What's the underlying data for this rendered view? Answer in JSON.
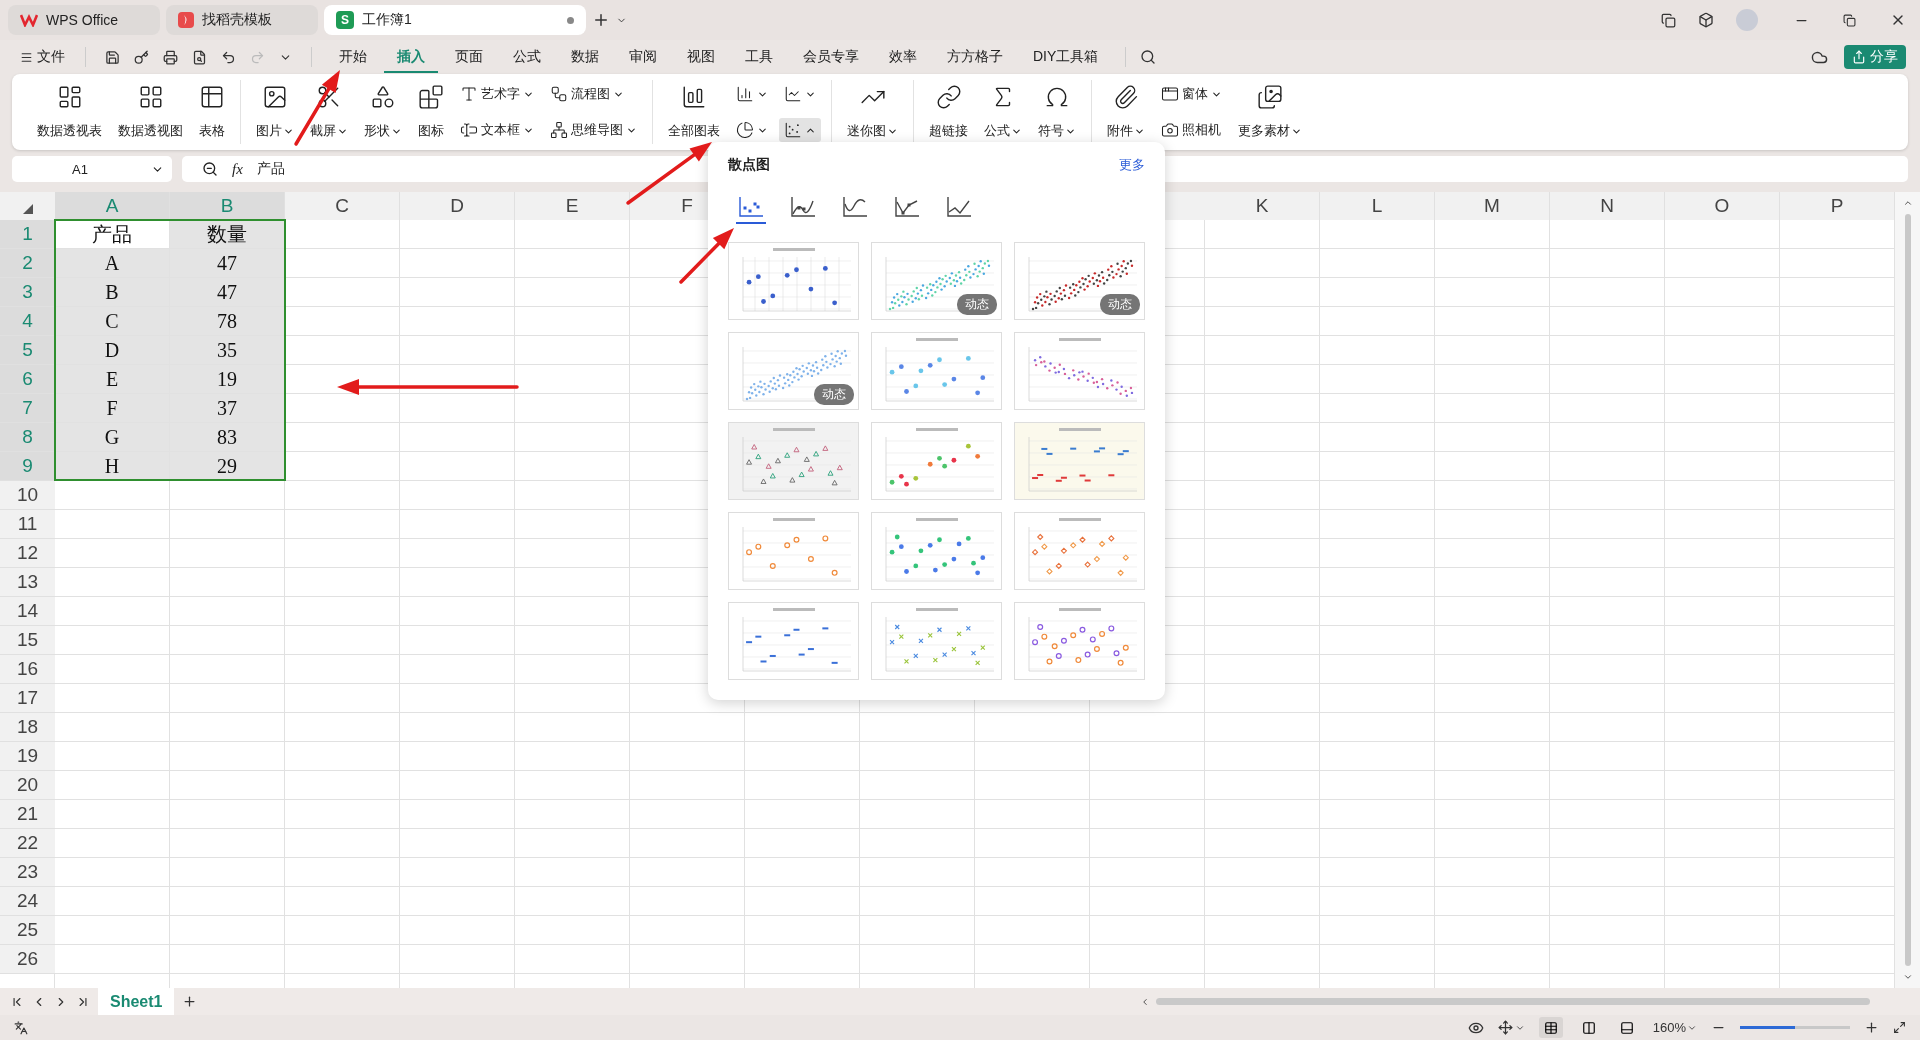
{
  "title_bar": {
    "tabs": [
      {
        "label": "WPS Office",
        "selected": false,
        "kind": "wps"
      },
      {
        "label": "找稻壳模板",
        "selected": false,
        "kind": "docer"
      },
      {
        "label": "工作簿1",
        "selected": true,
        "kind": "sheet",
        "logo": "S",
        "unsaved": true
      }
    ]
  },
  "menu": {
    "file": "文件",
    "quick_access": [
      {
        "disabled": false
      },
      {
        "disabled": false
      },
      {
        "disabled": false
      },
      {
        "disabled": false
      },
      {
        "disabled": false
      },
      {
        "disabled": true
      },
      {
        "disabled": false
      }
    ],
    "tabs": [
      {
        "label": "开始",
        "selected": false
      },
      {
        "label": "插入",
        "selected": true
      },
      {
        "label": "页面",
        "selected": false
      },
      {
        "label": "公式",
        "selected": false
      },
      {
        "label": "数据",
        "selected": false
      },
      {
        "label": "审阅",
        "selected": false
      },
      {
        "label": "视图",
        "selected": false
      },
      {
        "label": "工具",
        "selected": false
      },
      {
        "label": "会员专享",
        "selected": false
      },
      {
        "label": "效率",
        "selected": false
      },
      {
        "label": "方方格子",
        "selected": false
      },
      {
        "label": "DIY工具箱",
        "selected": false
      }
    ],
    "share": "分享"
  },
  "ribbon": {
    "groups": [
      {
        "columns": [
          {
            "kind": "large",
            "items": [
              {
                "label": "数据透视表",
                "caret": false
              }
            ]
          },
          {
            "kind": "large",
            "items": [
              {
                "label": "数据透视图",
                "caret": false
              }
            ]
          },
          {
            "kind": "large",
            "items": [
              {
                "label": "表格",
                "caret": false
              }
            ]
          }
        ]
      },
      {
        "columns": [
          {
            "kind": "large",
            "items": [
              {
                "label": "图片",
                "caret": true
              }
            ]
          },
          {
            "kind": "large",
            "items": [
              {
                "label": "截屏",
                "caret": true
              }
            ]
          },
          {
            "kind": "large",
            "items": [
              {
                "label": "形状",
                "caret": true
              }
            ]
          },
          {
            "kind": "large",
            "items": [
              {
                "label": "图标",
                "caret": false
              }
            ]
          },
          {
            "kind": "stack",
            "items": [
              {
                "label": "艺术字",
                "caret": true
              },
              {
                "label": "文本框",
                "caret": true
              }
            ]
          },
          {
            "kind": "stack",
            "items": [
              {
                "label": "流程图",
                "caret": true
              },
              {
                "label": "思维导图",
                "caret": true
              }
            ]
          }
        ]
      },
      {
        "columns": [
          {
            "kind": "large",
            "items": [
              {
                "label": "全部图表",
                "caret": false
              }
            ]
          },
          {
            "kind": "stack",
            "items": [
              {
                "caret": true,
                "open": false
              },
              {
                "caret": true,
                "open": false
              }
            ]
          },
          {
            "kind": "stack",
            "items": [
              {
                "caret": true,
                "open": false
              },
              {
                "caret": true,
                "open": true
              }
            ]
          }
        ]
      },
      {
        "columns": [
          {
            "kind": "large",
            "items": [
              {
                "label": "迷你图",
                "caret": true
              }
            ]
          }
        ]
      },
      {
        "columns": [
          {
            "kind": "large",
            "items": [
              {
                "label": "超链接",
                "caret": false
              }
            ]
          },
          {
            "kind": "large",
            "items": [
              {
                "label": "公式",
                "caret": true
              }
            ]
          },
          {
            "kind": "large",
            "items": [
              {
                "label": "符号",
                "caret": true
              }
            ]
          }
        ]
      },
      {
        "columns": [
          {
            "kind": "large",
            "items": [
              {
                "label": "附件",
                "caret": true
              }
            ]
          },
          {
            "kind": "stack",
            "items": [
              {
                "label": "窗体",
                "caret": true
              },
              {
                "label": "照相机",
                "caret": false
              }
            ]
          },
          {
            "kind": "large",
            "items": [
              {
                "label": "更多素材",
                "caret": true
              }
            ]
          }
        ]
      }
    ]
  },
  "formula_bar": {
    "name_box": "A1",
    "fx": "fx",
    "formula": "产品"
  },
  "sheet": {
    "columns": [
      {
        "label": "A",
        "selected": true
      },
      {
        "label": "B",
        "selected": true
      },
      {
        "label": "C",
        "selected": false
      },
      {
        "label": "D",
        "selected": false
      },
      {
        "label": "E",
        "selected": false
      },
      {
        "label": "F",
        "selected": false
      },
      {
        "label": "K",
        "selected": false
      },
      {
        "label": "L",
        "selected": false
      },
      {
        "label": "M",
        "selected": false
      },
      {
        "label": "N",
        "selected": false
      },
      {
        "label": "O",
        "selected": false
      },
      {
        "label": "P",
        "selected": false
      }
    ],
    "rows": [
      {
        "label": "1",
        "selected": true,
        "cells": [
          {
            "text": "产品",
            "active": true
          },
          {
            "text": "数量",
            "active": false
          }
        ]
      },
      {
        "label": "2",
        "selected": true,
        "cells": [
          {
            "text": "A",
            "active": false
          },
          {
            "text": "47",
            "active": false
          }
        ]
      },
      {
        "label": "3",
        "selected": true,
        "cells": [
          {
            "text": "B",
            "active": false
          },
          {
            "text": "47",
            "active": false
          }
        ]
      },
      {
        "label": "4",
        "selected": true,
        "cells": [
          {
            "text": "C",
            "active": false
          },
          {
            "text": "78",
            "active": false
          }
        ]
      },
      {
        "label": "5",
        "selected": true,
        "cells": [
          {
            "text": "D",
            "active": false
          },
          {
            "text": "35",
            "active": false
          }
        ]
      },
      {
        "label": "6",
        "selected": true,
        "cells": [
          {
            "text": "E",
            "active": false
          },
          {
            "text": "19",
            "active": false
          }
        ]
      },
      {
        "label": "7",
        "selected": true,
        "cells": [
          {
            "text": "F",
            "active": false
          },
          {
            "text": "37",
            "active": false
          }
        ]
      },
      {
        "label": "8",
        "selected": true,
        "cells": [
          {
            "text": "G",
            "active": false
          },
          {
            "text": "83",
            "active": false
          }
        ]
      },
      {
        "label": "9",
        "selected": true,
        "cells": [
          {
            "text": "H",
            "active": false
          },
          {
            "text": "29",
            "active": false
          }
        ]
      },
      {
        "label": "10",
        "selected": false
      },
      {
        "label": "11",
        "selected": false
      },
      {
        "label": "12",
        "selected": false
      },
      {
        "label": "13",
        "selected": false
      },
      {
        "label": "14",
        "selected": false
      },
      {
        "label": "15",
        "selected": false
      },
      {
        "label": "16",
        "selected": false
      },
      {
        "label": "17",
        "selected": false
      },
      {
        "label": "18",
        "selected": false
      },
      {
        "label": "19",
        "selected": false
      },
      {
        "label": "20",
        "selected": false
      },
      {
        "label": "21",
        "selected": false
      },
      {
        "label": "22",
        "selected": false
      },
      {
        "label": "23",
        "selected": false
      },
      {
        "label": "24",
        "selected": false
      },
      {
        "label": "25",
        "selected": false
      },
      {
        "label": "26",
        "selected": false
      }
    ]
  },
  "chart_panel": {
    "title": "散点图",
    "more": "更多",
    "chart_types": [
      {
        "kind": "markers",
        "selected": true
      },
      {
        "kind": "smooth-markers",
        "selected": false
      },
      {
        "kind": "smooth",
        "selected": false
      },
      {
        "kind": "straight-markers",
        "selected": false
      },
      {
        "kind": "straight",
        "selected": false
      }
    ],
    "templates": [
      {
        "kind": "grid"
      },
      {
        "kind": "cloud-teal",
        "badge": "动态"
      },
      {
        "kind": "cloud-red",
        "badge": "动态"
      },
      {
        "kind": "cloud-blue",
        "badge": "动态"
      },
      {
        "kind": "circles-blue"
      },
      {
        "kind": "dense-pink"
      },
      {
        "kind": "triangles"
      },
      {
        "kind": "rising"
      },
      {
        "kind": "income"
      },
      {
        "kind": "rings-orange"
      },
      {
        "kind": "dots-blue-green"
      },
      {
        "kind": "diamonds-orange"
      },
      {
        "kind": "dashes-blue"
      },
      {
        "kind": "crosses"
      },
      {
        "kind": "rings-mix"
      }
    ]
  },
  "sheet_tabs": [
    {
      "label": "Sheet1",
      "selected": true
    }
  ],
  "status_bar": {
    "view_modes": [
      {
        "selected": true
      },
      {
        "selected": false
      },
      {
        "selected": false
      }
    ],
    "zoom": "160%",
    "zoom_slider": {
      "level": 0.5
    }
  }
}
